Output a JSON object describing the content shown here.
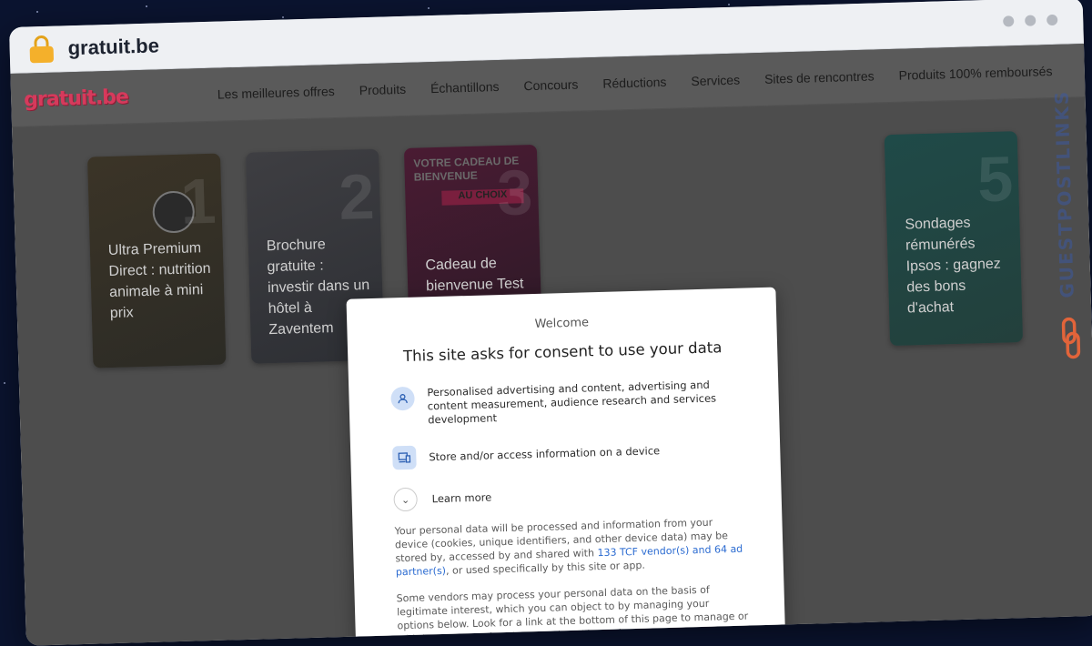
{
  "browser": {
    "url": "gratuit.be"
  },
  "site": {
    "logo": "gratuit.be",
    "nav": [
      "Les meilleures offres",
      "Produits",
      "Échantillons",
      "Concours",
      "Réductions",
      "Services",
      "Sites de rencontres",
      "Produits 100% remboursés"
    ],
    "cards": [
      {
        "num": "1",
        "title": "Ultra Premium Direct : nutrition animale à mini prix"
      },
      {
        "num": "2",
        "title": "Brochure gratuite : investir dans un hôtel à Zaventem"
      },
      {
        "num": "3",
        "title": "Cadeau de bienvenue Test Achats à",
        "banner": "VOTRE CADEAU DE BIENVENUE",
        "banner2": "AU CHOIX"
      },
      {
        "num": "5",
        "title": "Sondages rémunérés Ipsos : gagnez des bons d'achat"
      }
    ]
  },
  "consent": {
    "welcome": "Welcome",
    "heading": "This site asks for consent to use your data",
    "purposes": [
      {
        "icon": "user-icon",
        "text": "Personalised advertising and content, advertising and content measurement, audience research and services development"
      },
      {
        "icon": "device-icon",
        "text": "Store and/or access information on a device"
      }
    ],
    "learn_more": "Learn more",
    "para1_before": "Your personal data will be processed and information from your device (cookies, unique identifiers, and other device data) may be stored by, accessed by and shared with ",
    "para1_link": "133 TCF vendor(s) and 64 ad partner(s)",
    "para1_after": ", or used specifically by this site or app.",
    "para2": "Some vendors may process your personal data on the basis of legitimate interest, which you can object to by managing your options below. Look for a link at the bottom of this page to manage or withdraw consent in privacy and cookie settings."
  },
  "watermark": {
    "text": "GUESTPOSTLINKS"
  }
}
